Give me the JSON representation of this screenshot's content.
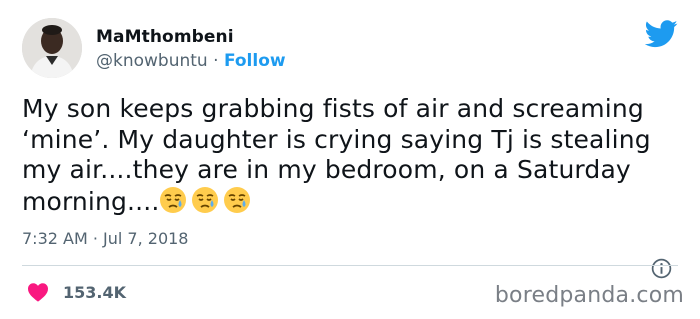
{
  "author": {
    "name": "MaMthombeni",
    "handle": "@knowbuntu",
    "separator": " · ",
    "follow_label": "Follow"
  },
  "tweet": {
    "text_lines": [
      "My son keeps grabbing fists of air and screaming",
      "‘mine’. My daughter is crying saying Tj is stealing",
      "my air....they are in my bedroom, on a Saturday",
      "morning...."
    ],
    "emojis": [
      "sad-but-relieved-face",
      "sad-but-relieved-face",
      "sad-but-relieved-face"
    ],
    "timestamp": "7:32 AM · Jul 7, 2018"
  },
  "engagement": {
    "likes": "153.4K"
  },
  "watermark": "boredpanda.com",
  "colors": {
    "accent": "#1d9bf0",
    "like": "#f91880",
    "muted": "#536471"
  }
}
